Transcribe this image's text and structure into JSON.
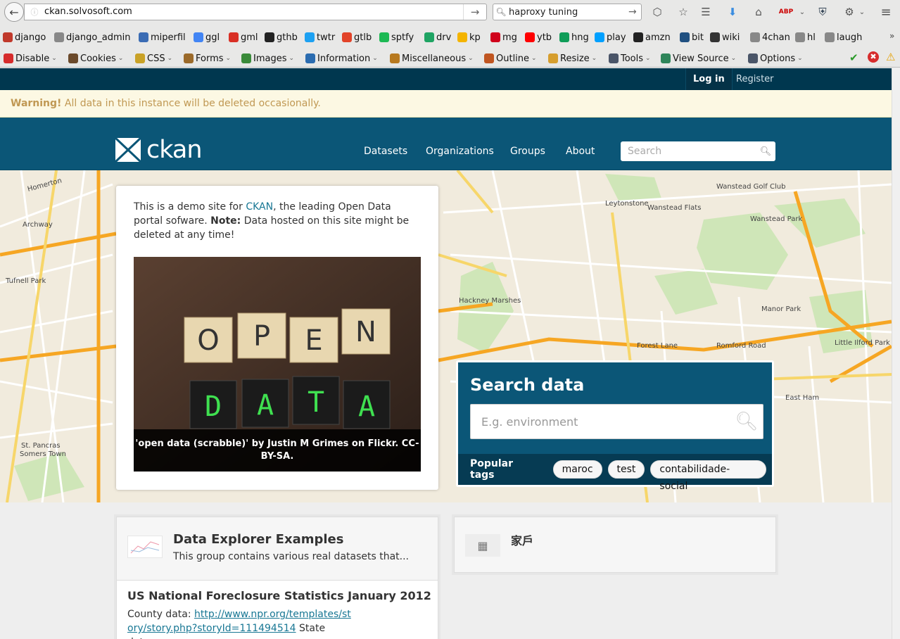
{
  "browser": {
    "url": "ckan.solvosoft.com",
    "search_query": "haproxy tuning",
    "bookmarks": [
      {
        "label": "django",
        "color": "#c0392b",
        "icon": "calendar-icon"
      },
      {
        "label": "django_admin",
        "color": "#888888",
        "icon": "globe-icon"
      },
      {
        "label": "miperfil",
        "color": "#3b6cb4",
        "icon": "uc-icon"
      },
      {
        "label": "ggl",
        "color": "#4285f4",
        "icon": "google-icon"
      },
      {
        "label": "gml",
        "color": "#d93025",
        "icon": "gmail-icon"
      },
      {
        "label": "gthb",
        "color": "#222222",
        "icon": "github-icon"
      },
      {
        "label": "twtr",
        "color": "#1da1f2",
        "icon": "twitter-icon"
      },
      {
        "label": "gtlb",
        "color": "#e24329",
        "icon": "gitlab-icon"
      },
      {
        "label": "sptfy",
        "color": "#1db954",
        "icon": "spotify-icon"
      },
      {
        "label": "drv",
        "color": "#1fa463",
        "icon": "drive-icon"
      },
      {
        "label": "kp",
        "color": "#f4b400",
        "icon": "keep-icon"
      },
      {
        "label": "mg",
        "color": "#d0021b",
        "icon": "mega-icon"
      },
      {
        "label": "ytb",
        "color": "#ff0000",
        "icon": "youtube-icon"
      },
      {
        "label": "hng",
        "color": "#0f9d58",
        "icon": "hangouts-icon"
      },
      {
        "label": "play",
        "color": "#00a0ff",
        "icon": "play-icon"
      },
      {
        "label": "amzn",
        "color": "#222222",
        "icon": "amazon-icon"
      },
      {
        "label": "bit",
        "color": "#205081",
        "icon": "bitbucket-icon"
      },
      {
        "label": "wiki",
        "color": "#333333",
        "icon": "wikipedia-icon"
      },
      {
        "label": "4chan",
        "color": "#888888",
        "icon": "globe-icon"
      },
      {
        "label": "hl",
        "color": "#888888",
        "icon": "globe-icon"
      },
      {
        "label": "laugh",
        "color": "#888888",
        "icon": "globe-icon"
      }
    ],
    "webdev_toolbar": [
      {
        "label": "Disable",
        "icon": "disable-icon"
      },
      {
        "label": "Cookies",
        "icon": "cookies-icon"
      },
      {
        "label": "CSS",
        "icon": "css-icon"
      },
      {
        "label": "Forms",
        "icon": "forms-icon"
      },
      {
        "label": "Images",
        "icon": "images-icon"
      },
      {
        "label": "Information",
        "icon": "information-icon"
      },
      {
        "label": "Miscellaneous",
        "icon": "miscellaneous-icon"
      },
      {
        "label": "Outline",
        "icon": "outline-icon"
      },
      {
        "label": "Resize",
        "icon": "resize-icon"
      },
      {
        "label": "Tools",
        "icon": "tools-icon"
      },
      {
        "label": "View Source",
        "icon": "view-source-icon"
      },
      {
        "label": "Options",
        "icon": "options-icon"
      }
    ]
  },
  "account": {
    "login": "Log in",
    "register": "Register"
  },
  "warning": {
    "strong": "Warning!",
    "text": " All data in this instance will be deleted occasionally."
  },
  "header": {
    "logo_text": "ckan",
    "nav": [
      "Datasets",
      "Organizations",
      "Groups",
      "About"
    ],
    "search_placeholder": "Search"
  },
  "intro": {
    "text_before": "This is a demo site for ",
    "ckan_link": "CKAN",
    "text_mid": ", the leading Open Data portal sofware. ",
    "note_strong": "Note:",
    "text_after": " Data hosted on this site might be deleted at any time!",
    "image_caption": "'open data (scrabble)' by Justin M Grimes on Flickr. CC-BY-SA.",
    "tiles_top": [
      "O",
      "P",
      "E",
      "N"
    ],
    "tiles_bottom": [
      "D",
      "A",
      "T",
      "A"
    ]
  },
  "search_data": {
    "title": "Search data",
    "placeholder": "E.g. environment",
    "popular_label": "Popular tags",
    "tags": [
      "maroc",
      "test",
      "contabilidade-social"
    ]
  },
  "group": {
    "title": "Data Explorer Examples",
    "description": "This group contains various real datasets that...",
    "dataset_title": "US National Foreclosure Statistics January 2012",
    "notes_prefix": "County data: ",
    "notes_link": "http://www.npr.org/templates/story/story.php?storyId=111494514",
    "notes_suffix": " State data:..."
  },
  "organization": {
    "title": "家戶"
  },
  "map_labels": [
    "Homerton",
    "Archway",
    "Tufnell Park",
    "Leytonstone",
    "Wanstead Flats",
    "Wanstead Park",
    "Hackney Marshes",
    "Forest Lane",
    "Manor Park",
    "East Ham",
    "Somers Town",
    "St. Pancras",
    "Wanstead Golf Club",
    "Little Ilford Park",
    "Romford Road"
  ]
}
